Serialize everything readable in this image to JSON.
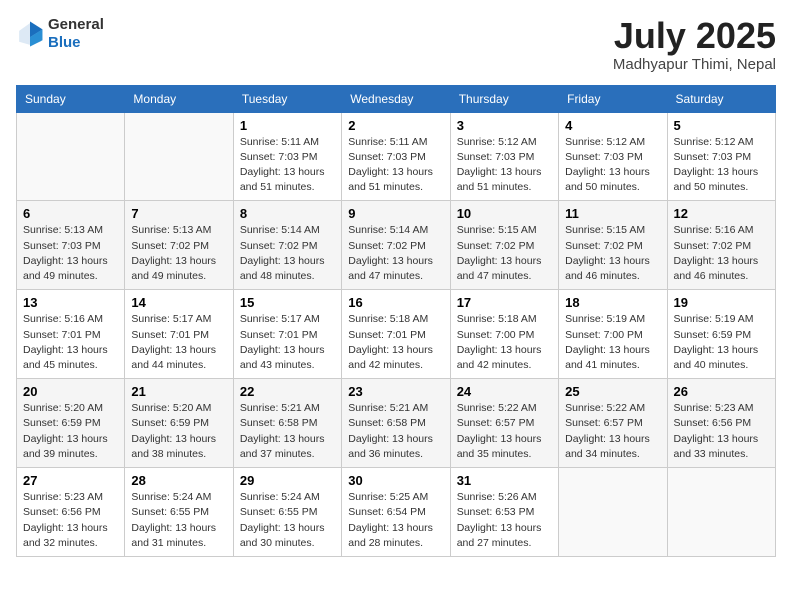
{
  "header": {
    "logo_general": "General",
    "logo_blue": "Blue",
    "month_title": "July 2025",
    "location": "Madhyapur Thimi, Nepal"
  },
  "days_of_week": [
    "Sunday",
    "Monday",
    "Tuesday",
    "Wednesday",
    "Thursday",
    "Friday",
    "Saturday"
  ],
  "weeks": [
    [
      {
        "day": "",
        "sunrise": "",
        "sunset": "",
        "daylight": ""
      },
      {
        "day": "",
        "sunrise": "",
        "sunset": "",
        "daylight": ""
      },
      {
        "day": "1",
        "sunrise": "Sunrise: 5:11 AM",
        "sunset": "Sunset: 7:03 PM",
        "daylight": "Daylight: 13 hours and 51 minutes."
      },
      {
        "day": "2",
        "sunrise": "Sunrise: 5:11 AM",
        "sunset": "Sunset: 7:03 PM",
        "daylight": "Daylight: 13 hours and 51 minutes."
      },
      {
        "day": "3",
        "sunrise": "Sunrise: 5:12 AM",
        "sunset": "Sunset: 7:03 PM",
        "daylight": "Daylight: 13 hours and 51 minutes."
      },
      {
        "day": "4",
        "sunrise": "Sunrise: 5:12 AM",
        "sunset": "Sunset: 7:03 PM",
        "daylight": "Daylight: 13 hours and 50 minutes."
      },
      {
        "day": "5",
        "sunrise": "Sunrise: 5:12 AM",
        "sunset": "Sunset: 7:03 PM",
        "daylight": "Daylight: 13 hours and 50 minutes."
      }
    ],
    [
      {
        "day": "6",
        "sunrise": "Sunrise: 5:13 AM",
        "sunset": "Sunset: 7:03 PM",
        "daylight": "Daylight: 13 hours and 49 minutes."
      },
      {
        "day": "7",
        "sunrise": "Sunrise: 5:13 AM",
        "sunset": "Sunset: 7:02 PM",
        "daylight": "Daylight: 13 hours and 49 minutes."
      },
      {
        "day": "8",
        "sunrise": "Sunrise: 5:14 AM",
        "sunset": "Sunset: 7:02 PM",
        "daylight": "Daylight: 13 hours and 48 minutes."
      },
      {
        "day": "9",
        "sunrise": "Sunrise: 5:14 AM",
        "sunset": "Sunset: 7:02 PM",
        "daylight": "Daylight: 13 hours and 47 minutes."
      },
      {
        "day": "10",
        "sunrise": "Sunrise: 5:15 AM",
        "sunset": "Sunset: 7:02 PM",
        "daylight": "Daylight: 13 hours and 47 minutes."
      },
      {
        "day": "11",
        "sunrise": "Sunrise: 5:15 AM",
        "sunset": "Sunset: 7:02 PM",
        "daylight": "Daylight: 13 hours and 46 minutes."
      },
      {
        "day": "12",
        "sunrise": "Sunrise: 5:16 AM",
        "sunset": "Sunset: 7:02 PM",
        "daylight": "Daylight: 13 hours and 46 minutes."
      }
    ],
    [
      {
        "day": "13",
        "sunrise": "Sunrise: 5:16 AM",
        "sunset": "Sunset: 7:01 PM",
        "daylight": "Daylight: 13 hours and 45 minutes."
      },
      {
        "day": "14",
        "sunrise": "Sunrise: 5:17 AM",
        "sunset": "Sunset: 7:01 PM",
        "daylight": "Daylight: 13 hours and 44 minutes."
      },
      {
        "day": "15",
        "sunrise": "Sunrise: 5:17 AM",
        "sunset": "Sunset: 7:01 PM",
        "daylight": "Daylight: 13 hours and 43 minutes."
      },
      {
        "day": "16",
        "sunrise": "Sunrise: 5:18 AM",
        "sunset": "Sunset: 7:01 PM",
        "daylight": "Daylight: 13 hours and 42 minutes."
      },
      {
        "day": "17",
        "sunrise": "Sunrise: 5:18 AM",
        "sunset": "Sunset: 7:00 PM",
        "daylight": "Daylight: 13 hours and 42 minutes."
      },
      {
        "day": "18",
        "sunrise": "Sunrise: 5:19 AM",
        "sunset": "Sunset: 7:00 PM",
        "daylight": "Daylight: 13 hours and 41 minutes."
      },
      {
        "day": "19",
        "sunrise": "Sunrise: 5:19 AM",
        "sunset": "Sunset: 6:59 PM",
        "daylight": "Daylight: 13 hours and 40 minutes."
      }
    ],
    [
      {
        "day": "20",
        "sunrise": "Sunrise: 5:20 AM",
        "sunset": "Sunset: 6:59 PM",
        "daylight": "Daylight: 13 hours and 39 minutes."
      },
      {
        "day": "21",
        "sunrise": "Sunrise: 5:20 AM",
        "sunset": "Sunset: 6:59 PM",
        "daylight": "Daylight: 13 hours and 38 minutes."
      },
      {
        "day": "22",
        "sunrise": "Sunrise: 5:21 AM",
        "sunset": "Sunset: 6:58 PM",
        "daylight": "Daylight: 13 hours and 37 minutes."
      },
      {
        "day": "23",
        "sunrise": "Sunrise: 5:21 AM",
        "sunset": "Sunset: 6:58 PM",
        "daylight": "Daylight: 13 hours and 36 minutes."
      },
      {
        "day": "24",
        "sunrise": "Sunrise: 5:22 AM",
        "sunset": "Sunset: 6:57 PM",
        "daylight": "Daylight: 13 hours and 35 minutes."
      },
      {
        "day": "25",
        "sunrise": "Sunrise: 5:22 AM",
        "sunset": "Sunset: 6:57 PM",
        "daylight": "Daylight: 13 hours and 34 minutes."
      },
      {
        "day": "26",
        "sunrise": "Sunrise: 5:23 AM",
        "sunset": "Sunset: 6:56 PM",
        "daylight": "Daylight: 13 hours and 33 minutes."
      }
    ],
    [
      {
        "day": "27",
        "sunrise": "Sunrise: 5:23 AM",
        "sunset": "Sunset: 6:56 PM",
        "daylight": "Daylight: 13 hours and 32 minutes."
      },
      {
        "day": "28",
        "sunrise": "Sunrise: 5:24 AM",
        "sunset": "Sunset: 6:55 PM",
        "daylight": "Daylight: 13 hours and 31 minutes."
      },
      {
        "day": "29",
        "sunrise": "Sunrise: 5:24 AM",
        "sunset": "Sunset: 6:55 PM",
        "daylight": "Daylight: 13 hours and 30 minutes."
      },
      {
        "day": "30",
        "sunrise": "Sunrise: 5:25 AM",
        "sunset": "Sunset: 6:54 PM",
        "daylight": "Daylight: 13 hours and 28 minutes."
      },
      {
        "day": "31",
        "sunrise": "Sunrise: 5:26 AM",
        "sunset": "Sunset: 6:53 PM",
        "daylight": "Daylight: 13 hours and 27 minutes."
      },
      {
        "day": "",
        "sunrise": "",
        "sunset": "",
        "daylight": ""
      },
      {
        "day": "",
        "sunrise": "",
        "sunset": "",
        "daylight": ""
      }
    ]
  ]
}
